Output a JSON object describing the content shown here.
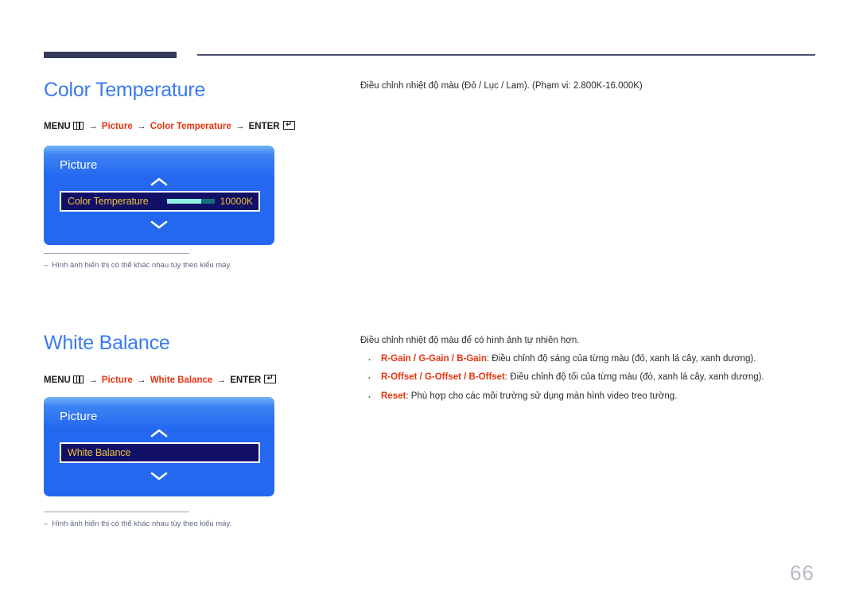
{
  "page": {
    "number": "66"
  },
  "sections": [
    {
      "title": "Color Temperature",
      "menu_path": {
        "menu_label": "MENU",
        "menu_icon": "menu-grid-icon",
        "arrow": "→",
        "step1": "Picture",
        "step2": "Color Temperature",
        "enter_label": "ENTER",
        "enter_icon": "enter-key-icon"
      },
      "osd": {
        "title": "Picture",
        "up_icon": "chevron-up-icon",
        "down_icon": "chevron-down-icon",
        "row_label": "Color Temperature",
        "row_value": "10000K",
        "slider_fill_percent": 72,
        "has_slider": true
      },
      "footnote": {
        "dash": "–",
        "text": "Hình ảnh hiển thị có thể khác nhau tùy theo kiểu máy."
      },
      "description": "Điều chỉnh nhiệt độ màu (Đỏ / Lục / Lam). (Phạm vi: 2.800K-16.000K)",
      "bullets": []
    },
    {
      "title": "White Balance",
      "menu_path": {
        "menu_label": "MENU",
        "menu_icon": "menu-grid-icon",
        "arrow": "→",
        "step1": "Picture",
        "step2": "White Balance",
        "enter_label": "ENTER",
        "enter_icon": "enter-key-icon"
      },
      "osd": {
        "title": "Picture",
        "up_icon": "chevron-up-icon",
        "down_icon": "chevron-down-icon",
        "row_label": "White Balance",
        "row_value": "",
        "slider_fill_percent": 0,
        "has_slider": false
      },
      "footnote": {
        "dash": "–",
        "text": "Hình ảnh hiển thị có thể khác nhau tùy theo kiểu máy."
      },
      "description": "Điều chỉnh nhiệt độ màu để có hình ảnh tự nhiên hơn.",
      "bullets": [
        {
          "term": "R-Gain / G-Gain / B-Gain",
          "text": ": Điều chỉnh độ sáng của từng màu (đỏ, xanh lá cây, xanh dương)."
        },
        {
          "term": "R-Offset / G-Offset / B-Offset",
          "text": ": Điều chỉnh độ tối của từng màu (đỏ, xanh lá cây, xanh dương)."
        },
        {
          "term": "Reset",
          "text": ": Phù hợp cho các môi trường sử dụng màn hình video treo tường."
        }
      ]
    }
  ],
  "colors": {
    "heading_blue": "#3a7bf0",
    "accent_red": "#e8330e",
    "rule_navy": "#343a5e",
    "osd_blue": "#2468f0",
    "osd_row_navy": "#111066",
    "osd_row_text": "#f0c33c",
    "slider_fill": "#8ff0e4",
    "slider_track": "#1a6e7d",
    "page_number_gray": "#b8bcc6"
  }
}
